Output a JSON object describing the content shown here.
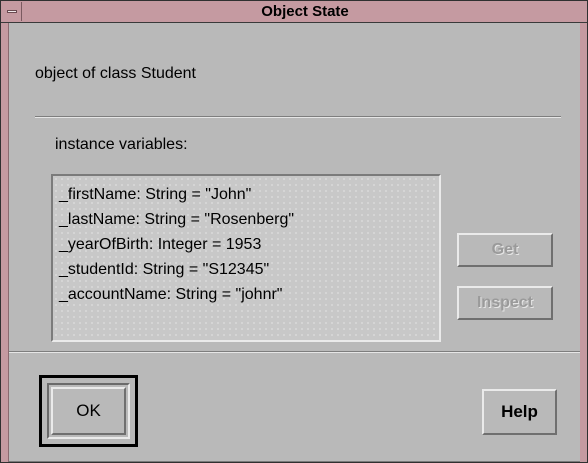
{
  "window": {
    "title": "Object State",
    "menu_icon": "window-menu-icon"
  },
  "object": {
    "class_label": "object of class Student"
  },
  "instance_vars": {
    "label": "instance variables:",
    "items": [
      "_firstName: String = \"John\"",
      "_lastName: String = \"Rosenberg\"",
      "_yearOfBirth: Integer = 1953",
      "_studentId: String = \"S12345\"",
      "_accountName: String = \"johnr\""
    ]
  },
  "buttons": {
    "get_label": "Get",
    "inspect_label": "Inspect",
    "ok_label": "OK",
    "help_label": "Help"
  },
  "colors": {
    "titlebar": "#c59aa1",
    "background": "#b9b9b9",
    "listbox": "#c8c8c8"
  }
}
